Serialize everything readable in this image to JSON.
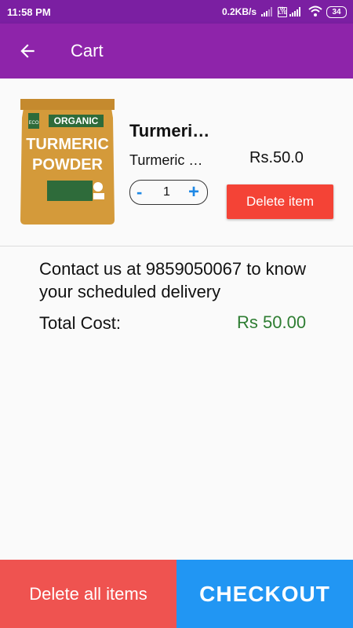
{
  "status_bar": {
    "time": "11:58 PM",
    "network_speed": "0.2KB/s",
    "battery": "34",
    "volte": "Vo LTE"
  },
  "app_bar": {
    "title": "Cart",
    "back_icon": "arrow-left-icon",
    "color": "#8e24aa"
  },
  "cart": {
    "items": [
      {
        "name": "Turmeric Powder",
        "subtitle": "Turmeric Powder",
        "price": "Rs.50.0",
        "quantity": "1",
        "qty_minus": "-",
        "qty_plus": "+",
        "delete_label": "Delete item",
        "image_text": {
          "eco": "ECO",
          "organic": "ORGANIC",
          "line1": "TURMERIC",
          "line2": "POWDER"
        }
      }
    ],
    "contact_text": "Contact us at 9859050067 to know your scheduled delivery",
    "total_label": "Total Cost:",
    "total_value": "Rs 50.00",
    "total_color": "#2e7d32"
  },
  "footer": {
    "delete_all_label": "Delete all items",
    "checkout_label": "CHECKOUT",
    "delete_all_color": "#ef5350",
    "checkout_color": "#2196f3"
  }
}
